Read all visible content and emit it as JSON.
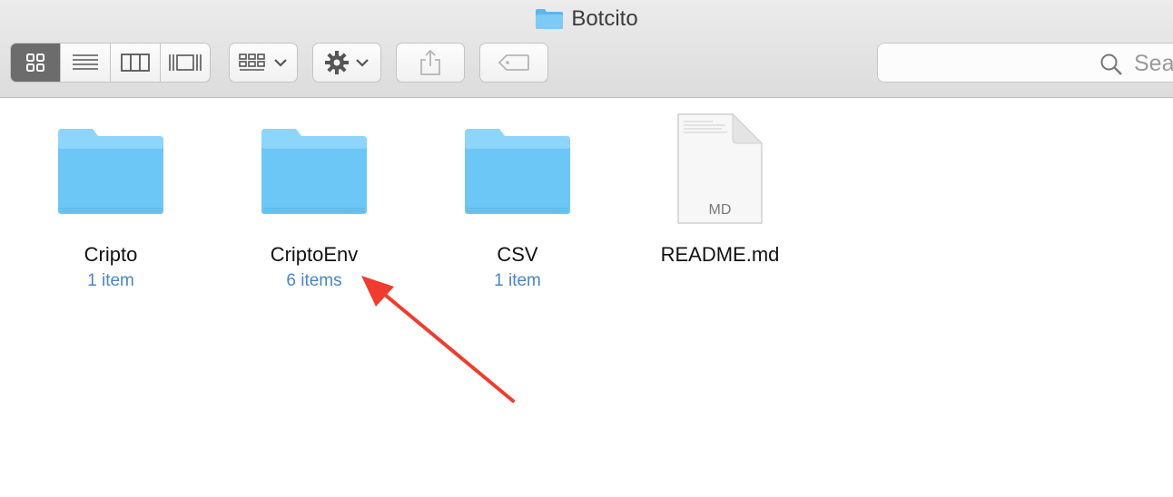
{
  "window": {
    "title": "Botcito",
    "folder_color": "#6ec6f5"
  },
  "toolbar": {
    "view_modes": [
      "icon-view",
      "list-view",
      "column-view",
      "cover-flow-view"
    ],
    "active_view": "icon-view",
    "search_placeholder": "Sea"
  },
  "files": [
    {
      "name": "Cripto",
      "count": "1 item",
      "kind": "folder"
    },
    {
      "name": "CriptoEnv",
      "count": "6 items",
      "kind": "folder"
    },
    {
      "name": "CSV",
      "count": "1 item",
      "kind": "folder"
    },
    {
      "name": "README.md",
      "count": "",
      "kind": "document",
      "badge": "MD"
    }
  ],
  "colors": {
    "folder_top": "#8dd5fb",
    "folder_body": "#6cc7f6",
    "item_count": "#4a84c9",
    "annotation_arrow": "#f03c2e"
  }
}
